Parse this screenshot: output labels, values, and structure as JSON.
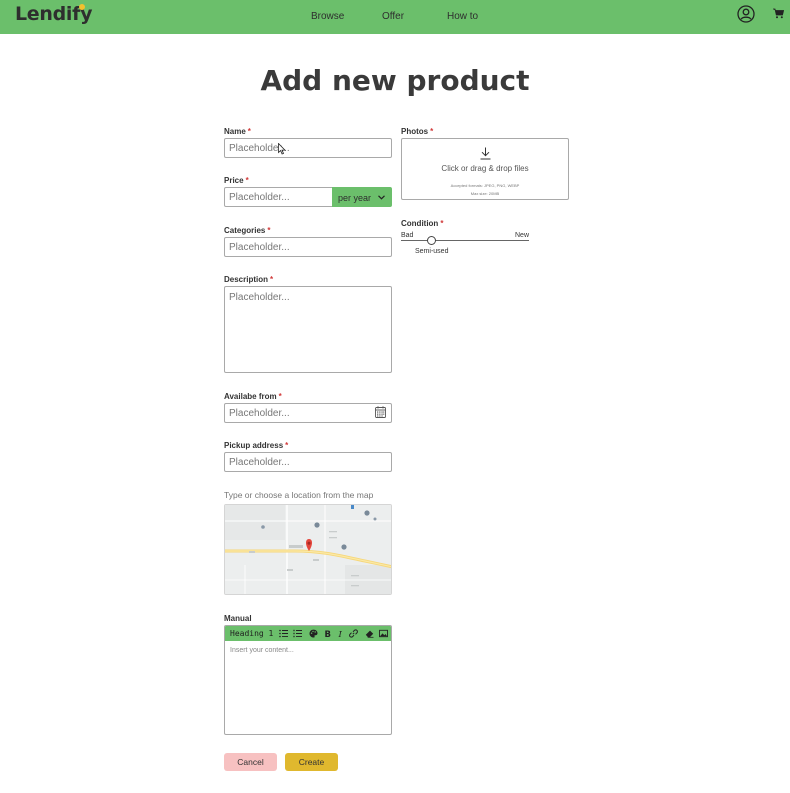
{
  "header": {
    "logo": "Lendify",
    "nav": [
      "Browse",
      "Offer",
      "How to"
    ],
    "icons": [
      "user-icon",
      "cart-icon"
    ],
    "accent_color": "#6bbf6b",
    "logo_dot_color": "#f2c12e"
  },
  "page_title": "Add new product",
  "form": {
    "name": {
      "label": "Name",
      "required": "*",
      "placeholder": "Placeholder..."
    },
    "price": {
      "label": "Price",
      "required": "*",
      "placeholder": "Placeholder...",
      "period": "per year"
    },
    "categories": {
      "label": "Categories",
      "required": "*",
      "placeholder": "Placeholder..."
    },
    "description": {
      "label": "Description",
      "required": "*",
      "placeholder": "Placeholder..."
    },
    "available_from": {
      "label": "Availabe from",
      "required": "*",
      "placeholder": "Placeholder..."
    },
    "pickup_address": {
      "label": "Pickup address",
      "required": "*",
      "placeholder": "Placeholder...",
      "map_hint": "Type or choose a location from the map"
    },
    "manual": {
      "label": "Manual",
      "heading_select": "Heading 1",
      "placeholder": "Insert your content..."
    }
  },
  "photos": {
    "label": "Photos",
    "required": "*",
    "drop_text": "Click or drag & drop files",
    "formats": "Accepted formats: JPEG, PNG, WEBP",
    "max_size": "Max size: 20MB"
  },
  "condition": {
    "label": "Condition",
    "required": "*",
    "min_label": "Bad",
    "max_label": "New",
    "value_label": "Semi-used",
    "value_fraction": 0.24
  },
  "buttons": {
    "cancel": "Cancel",
    "create": "Create",
    "cancel_color": "#f7c1c1",
    "create_color": "#e0b82e"
  }
}
